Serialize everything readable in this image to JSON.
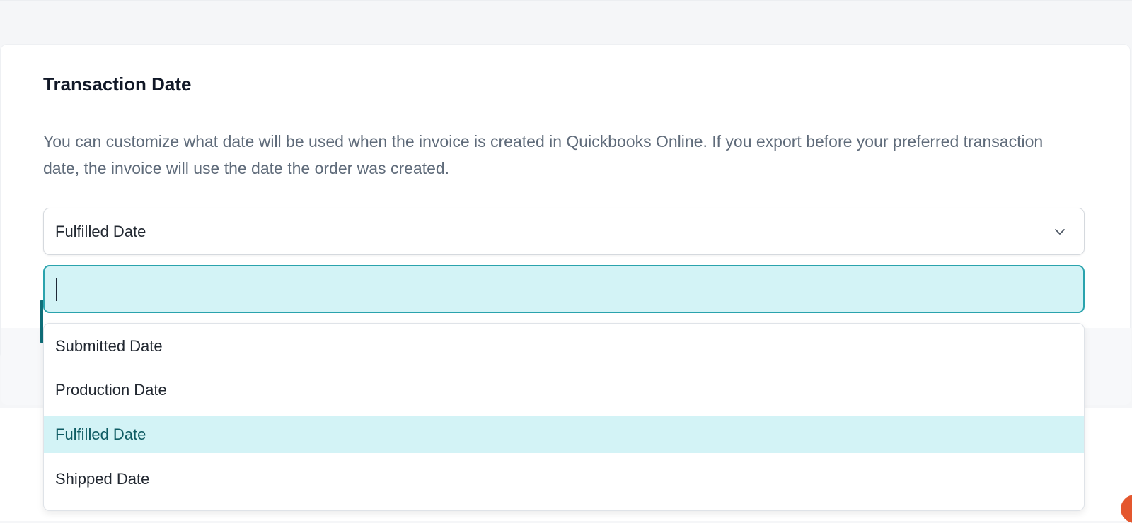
{
  "section": {
    "title": "Transaction Date",
    "description": "You can customize what date will be used when the invoice is created in Quickbooks Online. If you export before your preferred transaction date, the invoice will use the date the order was created."
  },
  "select": {
    "value": "Fulfilled Date",
    "icon": "chevron-down-icon"
  },
  "search": {
    "value": "",
    "placeholder": ""
  },
  "options": [
    {
      "label": "Submitted Date",
      "selected": false
    },
    {
      "label": "Production Date",
      "selected": false
    },
    {
      "label": "Fulfilled Date",
      "selected": true
    },
    {
      "label": "Shipped Date",
      "selected": false
    }
  ],
  "colors": {
    "accent": "#2aa3ad",
    "selected_bg": "#d3f3f6",
    "selected_text": "#0e5b63",
    "heading": "#111827",
    "body_text": "#5f6b7a"
  }
}
